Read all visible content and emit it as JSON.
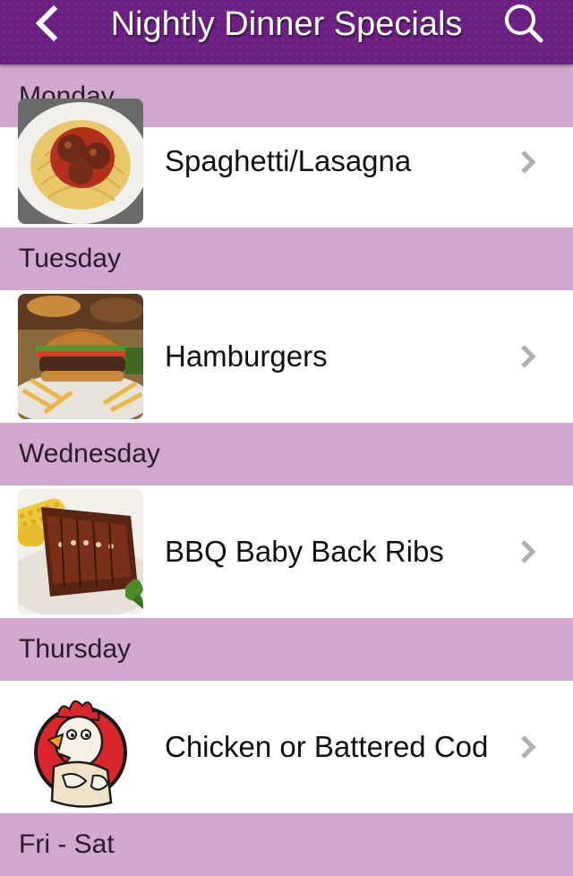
{
  "header": {
    "title": "Nightly Dinner Specials",
    "back_icon": "chevron-left-icon",
    "search_icon": "search-icon",
    "brand_color": "#6b1f82"
  },
  "colors": {
    "section_header_bg": "#d0a8d0",
    "row_bg": "#ffffff",
    "chevron": "#b0b0b0"
  },
  "sections": [
    {
      "day": "Monday",
      "item": {
        "label": "Spaghetti/Lasagna",
        "image": "spaghetti-photo"
      }
    },
    {
      "day": "Tuesday",
      "item": {
        "label": "Hamburgers",
        "image": "hamburger-photo"
      }
    },
    {
      "day": "Wednesday",
      "item": {
        "label": "BBQ Baby Back Ribs",
        "image": "ribs-photo"
      }
    },
    {
      "day": "Thursday",
      "item": {
        "label": "Chicken or Battered Cod",
        "image": "chicken-logo"
      }
    },
    {
      "day": "Fri - Sat"
    }
  ]
}
